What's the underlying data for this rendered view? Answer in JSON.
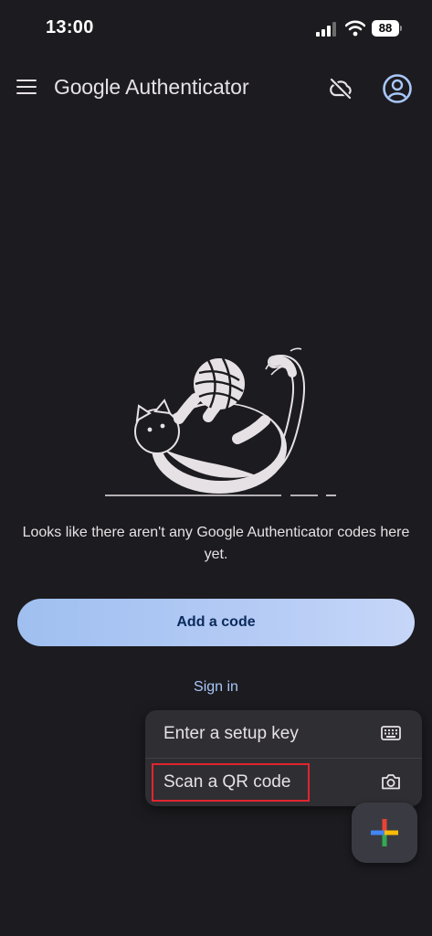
{
  "status_bar": {
    "time": "13:00",
    "battery": "88"
  },
  "app_bar": {
    "title_brand": "Google",
    "title_product": "Authenticator",
    "menu_icon": "hamburger-menu-icon",
    "cloud_icon": "cloud-off-icon",
    "account_icon": "account-circle-icon"
  },
  "empty_state": {
    "illustration": "cat-playing-with-yarn-illustration",
    "message": "Looks like there aren't any Google Authenticator codes here yet."
  },
  "actions": {
    "add_code_label": "Add a code",
    "sign_in_label": "Sign in"
  },
  "add_menu": {
    "items": [
      {
        "label": "Enter a setup key",
        "icon": "keyboard-icon"
      },
      {
        "label": "Scan a QR code",
        "icon": "camera-icon"
      }
    ]
  },
  "fab": {
    "icon": "plus-icon",
    "colors": [
      "#4285f4",
      "#ea4335",
      "#fbbc05",
      "#34a853"
    ]
  },
  "colors": {
    "background": "#1c1b1f",
    "accent": "#a8c7fa",
    "highlight": "#e0252f"
  }
}
